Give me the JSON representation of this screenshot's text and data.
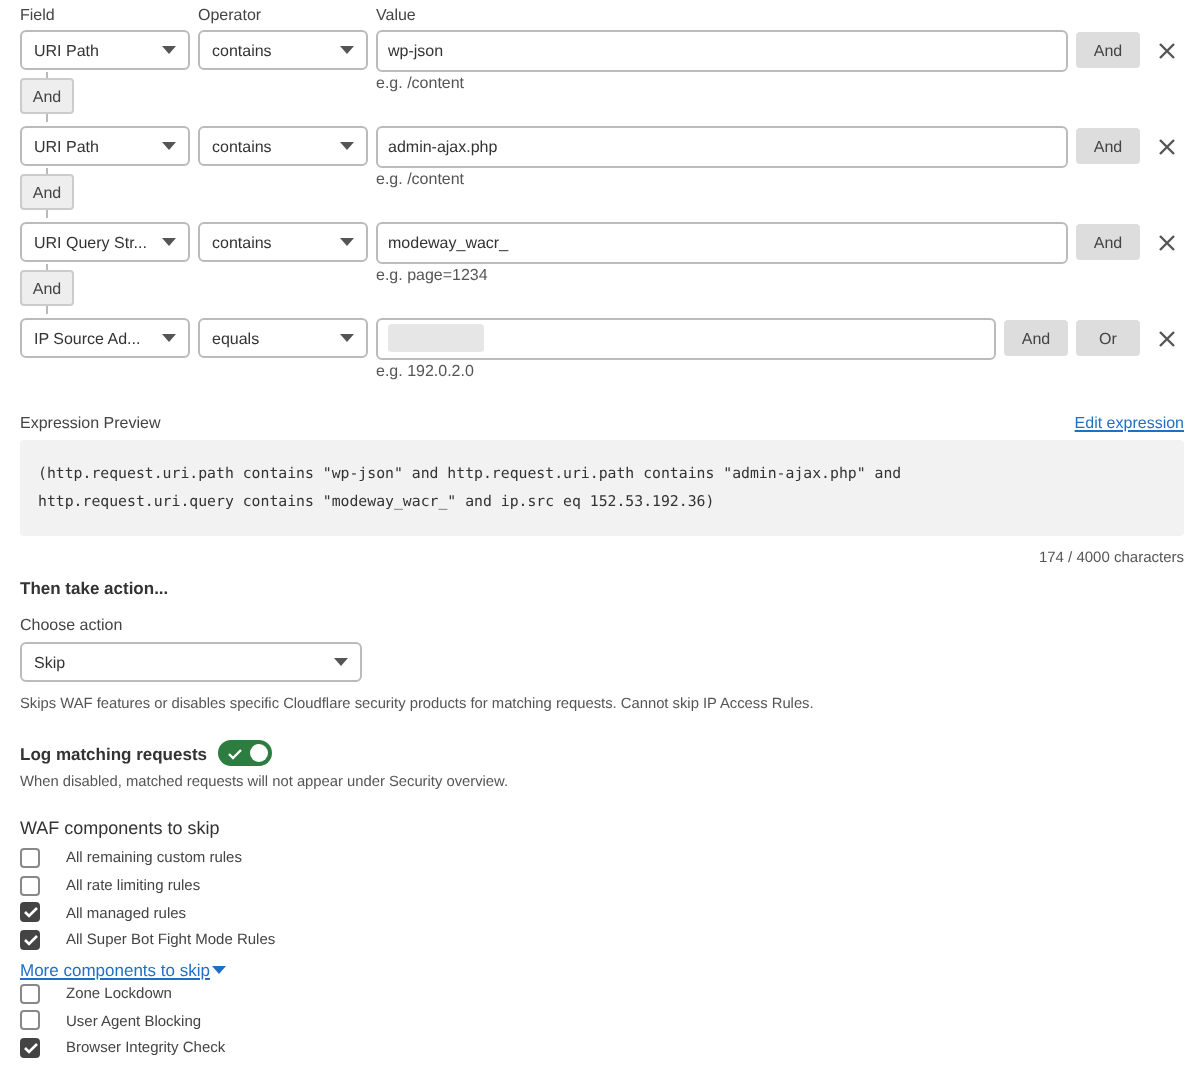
{
  "headers": [
    "Field",
    "Operator",
    "Value"
  ],
  "conditions": [
    {
      "field": "URI Path",
      "operator": "contains",
      "value": "wp-json",
      "redacted": false,
      "hint": "e.g. /content",
      "buttons": [
        "And"
      ],
      "connector": "And"
    },
    {
      "field": "URI Path",
      "operator": "contains",
      "value": "admin-ajax.php",
      "redacted": false,
      "hint": "e.g. /content",
      "buttons": [
        "And"
      ],
      "connector": "And"
    },
    {
      "field": "URI Query Str...",
      "operator": "contains",
      "value": "modeway_wacr_",
      "redacted": false,
      "hint": "e.g. page=1234",
      "buttons": [
        "And"
      ],
      "connector": "And"
    },
    {
      "field": "IP Source Ad...",
      "operator": "equals",
      "redacted": true,
      "hint": "e.g. 192.0.2.0",
      "buttons": [
        "And",
        "Or"
      ]
    }
  ],
  "preview": {
    "label": "Expression Preview",
    "edit_link": "Edit expression",
    "lines": [
      "(http.request.uri.path contains \"wp-json\" and http.request.uri.path contains \"admin-ajax.php\" and",
      "http.request.uri.query contains \"modeway_wacr_\" and ip.src eq 152.53.192.36)"
    ],
    "count": "174 / 4000 characters"
  },
  "action": {
    "heading": "Then take action...",
    "label": "Choose action",
    "value": "Skip",
    "description": "Skips WAF features or disables specific Cloudflare security products for matching requests. Cannot skip IP Access Rules."
  },
  "log": {
    "label": "Log matching requests",
    "on": true,
    "note": "When disabled, matched requests will not appear under Security overview."
  },
  "waf": {
    "heading": "WAF components to skip",
    "items": [
      {
        "label": "All remaining custom rules",
        "checked": false
      },
      {
        "label": "All rate limiting rules",
        "checked": false
      },
      {
        "label": "All managed rules",
        "checked": true
      },
      {
        "label": "All Super Bot Fight Mode Rules",
        "checked": true
      }
    ],
    "more_link": "More components to skip",
    "more_items": [
      {
        "label": "Zone Lockdown",
        "checked": false
      },
      {
        "label": "User Agent Blocking",
        "checked": false
      },
      {
        "label": "Browser Integrity Check",
        "checked": true
      }
    ]
  }
}
